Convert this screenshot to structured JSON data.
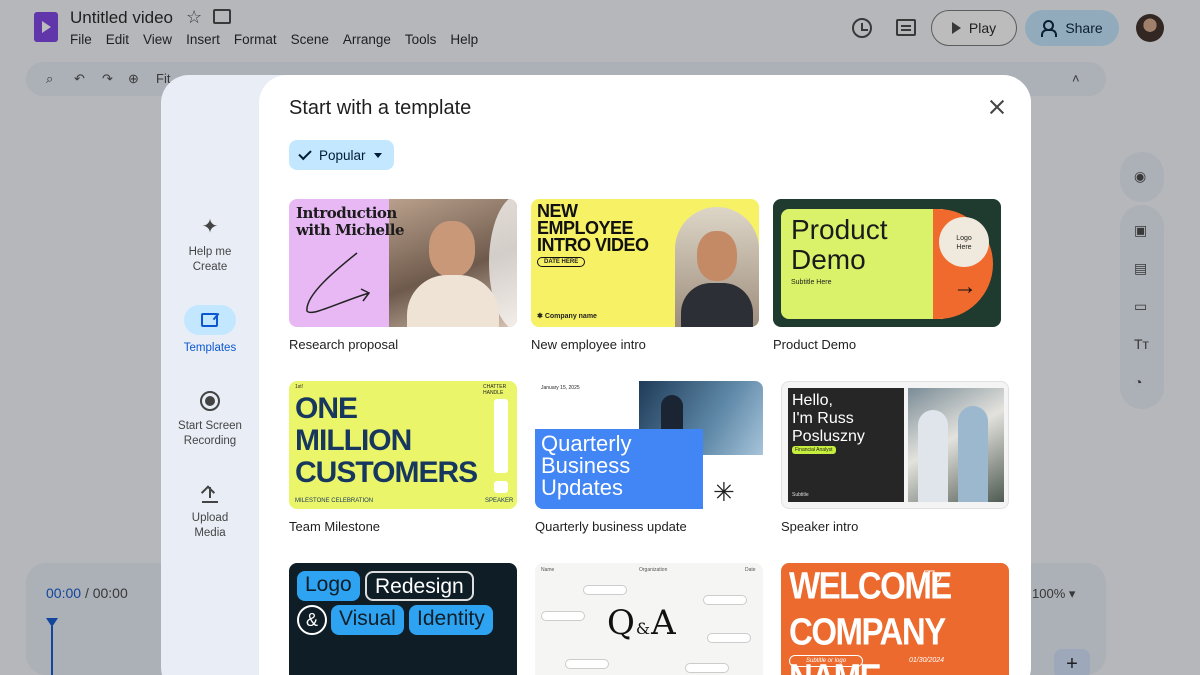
{
  "app": {
    "doc_title": "Untitled video",
    "menu": [
      "File",
      "Edit",
      "View",
      "Insert",
      "Format",
      "Scene",
      "Arrange",
      "Tools",
      "Help"
    ],
    "play_label": "Play",
    "share_label": "Share",
    "toolbar_fit": "Fit",
    "timecode_current": "00:00",
    "timecode_total": "/ 00:00",
    "zoom": "100%",
    "add_label": "+"
  },
  "modal": {
    "title": "Start with a template",
    "filter": {
      "label": "Popular",
      "selected": true
    },
    "side": [
      {
        "label_1": "Help me",
        "label_2": "Create",
        "icon": "sparkle-icon"
      },
      {
        "label_1": "Templates",
        "label_2": "",
        "icon": "templates-icon",
        "active": true
      },
      {
        "label_1": "Start Screen",
        "label_2": "Recording",
        "icon": "record-icon"
      },
      {
        "label_1": "Upload",
        "label_2": "Media",
        "icon": "upload-icon"
      }
    ],
    "templates": [
      {
        "caption": "Research proposal",
        "thumb_title_1": "Introduction",
        "thumb_title_2": "with Michelle"
      },
      {
        "caption": "New employee intro",
        "thumb_title_1": "NEW",
        "thumb_title_2": "EMPLOYEE",
        "thumb_title_3": "INTRO VIDEO",
        "chip": "DATE HERE",
        "company": "Company name"
      },
      {
        "caption": "Product Demo",
        "thumb_title_1": "Product",
        "thumb_title_2": "Demo",
        "subtitle": "Subtitle Here",
        "logo_1": "Logo",
        "logo_2": "Here"
      },
      {
        "caption": "Team Milestone",
        "thumb_title_1": "ONE",
        "thumb_title_2": "MILLION",
        "thumb_title_3": "CUSTOMERS",
        "foot_left": "MILESTONE CELEBRATION",
        "foot_right": "SPEAKER",
        "top_left": "1st!",
        "top_right": "CHATTER HANDLE"
      },
      {
        "caption": "Quarterly business update",
        "thumb_title_1": "Quarterly",
        "thumb_title_2": "Business",
        "thumb_title_3": "Updates",
        "date": "January 15, 2025"
      },
      {
        "caption": "Speaker intro",
        "thumb_title_1": "Hello,",
        "thumb_title_2": "I'm Russ",
        "thumb_title_3": "Posluszny",
        "tag": "Financial Analyst",
        "subtitle": "Subtitle"
      },
      {
        "caption": "",
        "thumb_word_1": "Logo",
        "thumb_word_2": "Redesign",
        "thumb_word_3": "&",
        "thumb_word_4": "Visual",
        "thumb_word_5": "Identity"
      },
      {
        "caption": "",
        "thumb_title": "Q",
        "thumb_amp": "&",
        "thumb_title_2": "A",
        "top_left": "Name",
        "top_mid": "Organization",
        "top_right": "Date"
      },
      {
        "caption": "",
        "thumb_title_1": "WELCOME",
        "thumb_title_2": "COMPANY NAME",
        "to": "To",
        "subtitle": "Subtitle or logo",
        "date": "01/30/2024"
      }
    ]
  }
}
